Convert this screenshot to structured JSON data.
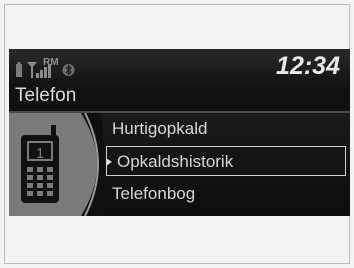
{
  "status": {
    "roaming": "RM",
    "time": "12:34",
    "icons": [
      "phone-battery-icon",
      "signal-strength-icon",
      "bluetooth-icon"
    ]
  },
  "screen": {
    "title": "Telefon"
  },
  "phone_graphic": {
    "line_number": "1"
  },
  "menu": {
    "items": [
      {
        "label": "Hurtigopkald",
        "selected": false
      },
      {
        "label": "Opkaldshistorik",
        "selected": true
      },
      {
        "label": "Telefonbog",
        "selected": false
      }
    ]
  },
  "colors": {
    "background": "#111111",
    "text": "#d6d6d6",
    "highlight_border": "#cfcfcf"
  }
}
